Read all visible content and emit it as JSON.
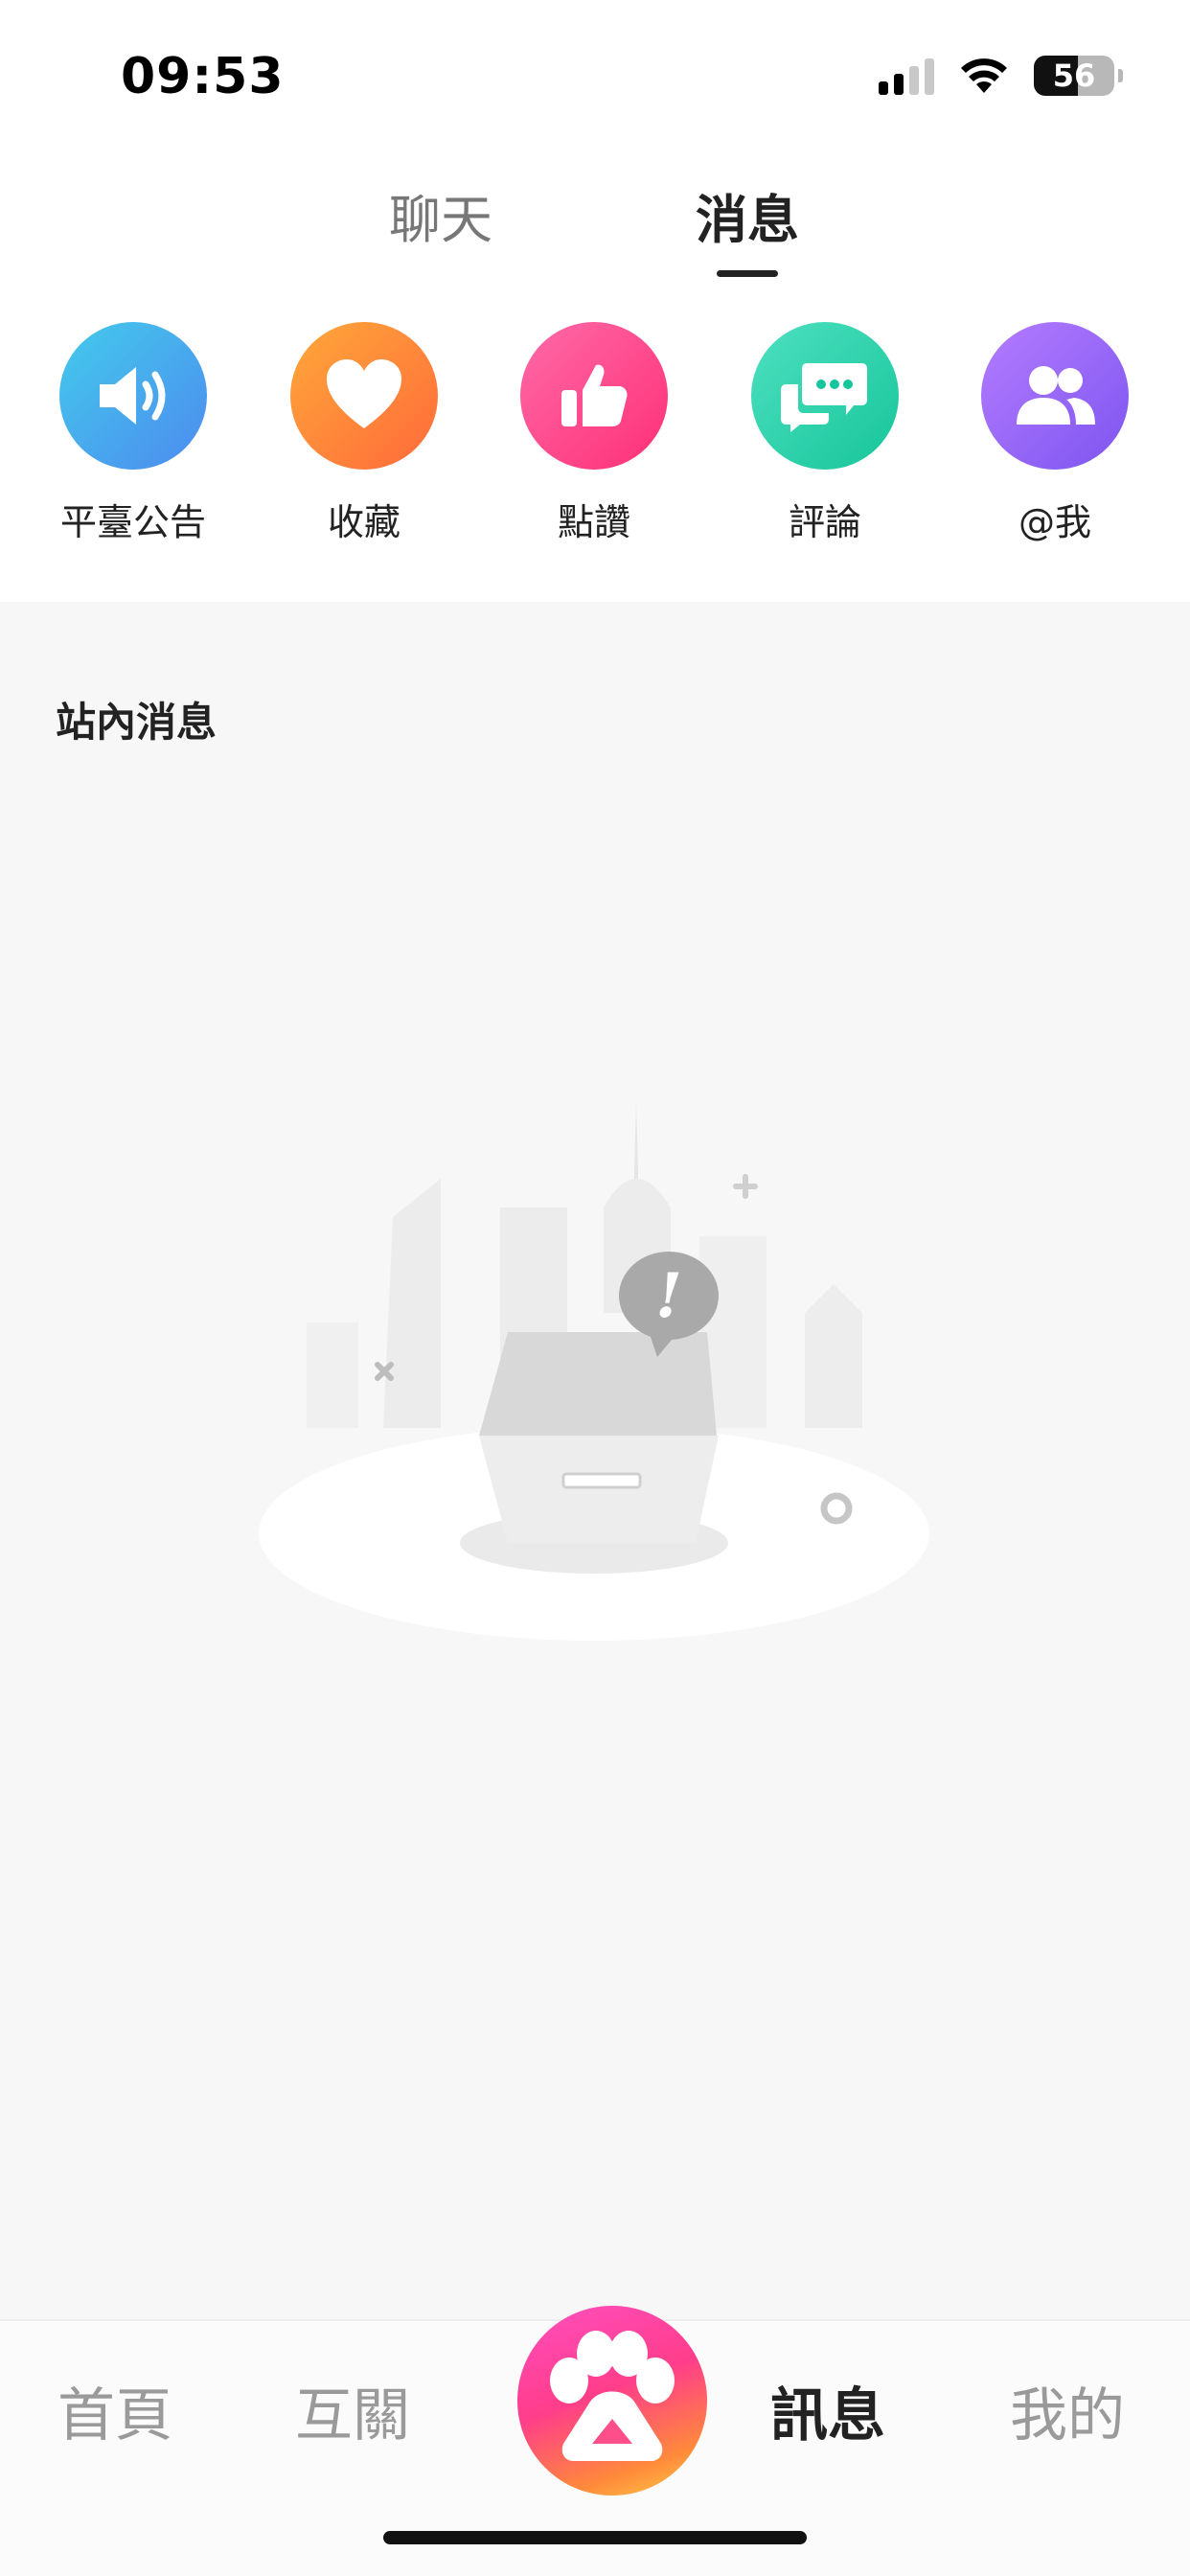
{
  "status_bar": {
    "time": "09:53",
    "battery": "56"
  },
  "tabs": [
    {
      "label": "聊天",
      "active": false
    },
    {
      "label": "消息",
      "active": true
    }
  ],
  "quick_actions": [
    {
      "label": "平臺公告",
      "icon": "speaker-icon",
      "color": "#4d8af0"
    },
    {
      "label": "收藏",
      "icon": "heart-icon",
      "color": "#ff6a3a"
    },
    {
      "label": "點讚",
      "icon": "thumbs-up-icon",
      "color": "#ff2f76"
    },
    {
      "label": "評論",
      "icon": "chat-bubbles-icon",
      "color": "#17c59a"
    },
    {
      "label": "@我",
      "icon": "people-icon",
      "color": "#7d55f0"
    }
  ],
  "section": {
    "title": "站內消息"
  },
  "bottom_nav": [
    {
      "label": "首頁",
      "active": false
    },
    {
      "label": "互關",
      "active": false
    },
    {
      "label": "訊息",
      "active": true
    },
    {
      "label": "我的",
      "active": false
    }
  ],
  "colors": {
    "active_text": "#222222",
    "inactive_text": "#9a9a9a"
  }
}
